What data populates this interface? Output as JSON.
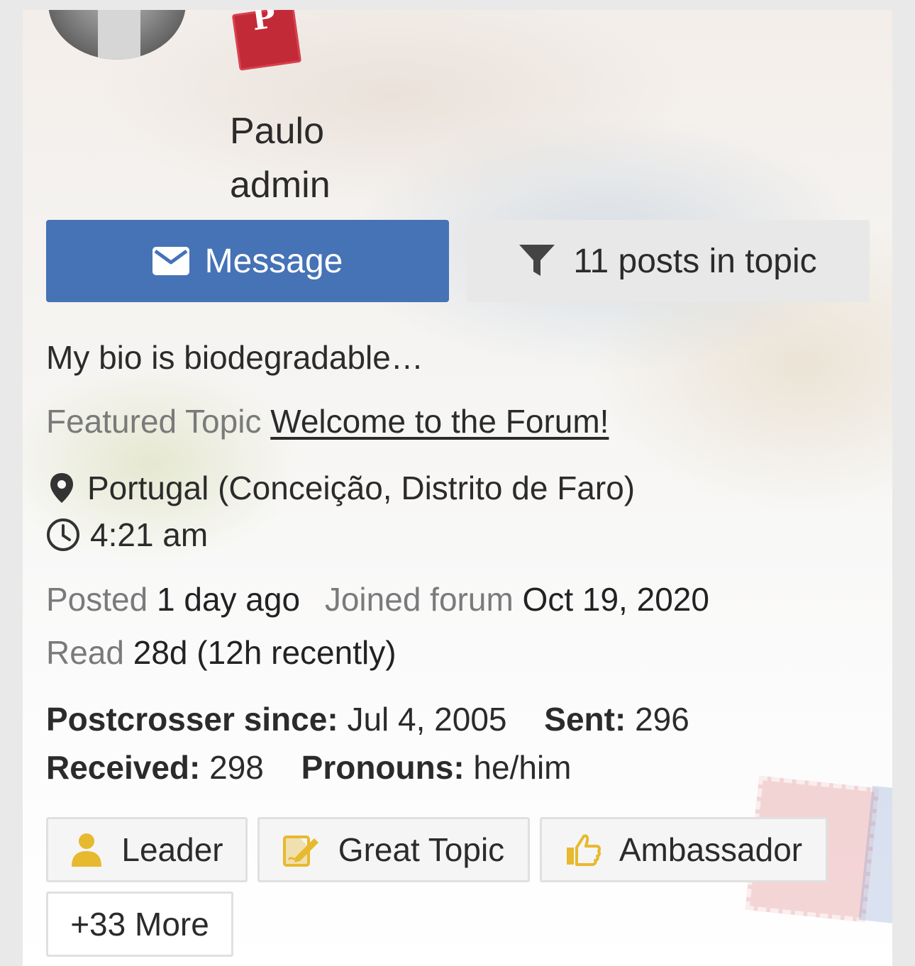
{
  "profile": {
    "name": "Paulo",
    "role": "admin",
    "bio": "My bio is biodegradable…",
    "badge_letter": "P"
  },
  "actions": {
    "message_label": "Message",
    "filter_label": "11 posts in topic"
  },
  "featured": {
    "label": "Featured Topic",
    "topic": "Welcome to the Forum!"
  },
  "location": "Portugal (Conceição, Distrito de Faro)",
  "local_time": "4:21 am",
  "stats": {
    "posted_label": "Posted",
    "posted_value": "1 day ago",
    "joined_label": "Joined forum",
    "joined_value": "Oct 19, 2020",
    "read_label": "Read",
    "read_value": "28d (12h recently)"
  },
  "postcrossing": {
    "since_label": "Postcrosser since:",
    "since_value": "Jul 4, 2005",
    "sent_label": "Sent:",
    "sent_value": "296",
    "received_label": "Received:",
    "received_value": "298",
    "pronouns_label": "Pronouns:",
    "pronouns_value": "he/him"
  },
  "badges": [
    {
      "label": "Leader",
      "icon": "user-icon"
    },
    {
      "label": "Great Topic",
      "icon": "edit-icon"
    },
    {
      "label": "Ambassador",
      "icon": "thumbs-up-icon"
    }
  ],
  "more_badges_label": "+33 More",
  "colors": {
    "accent": "#4672b6",
    "badge_gold": "#e7b92f",
    "brand_red": "#c32a37"
  }
}
